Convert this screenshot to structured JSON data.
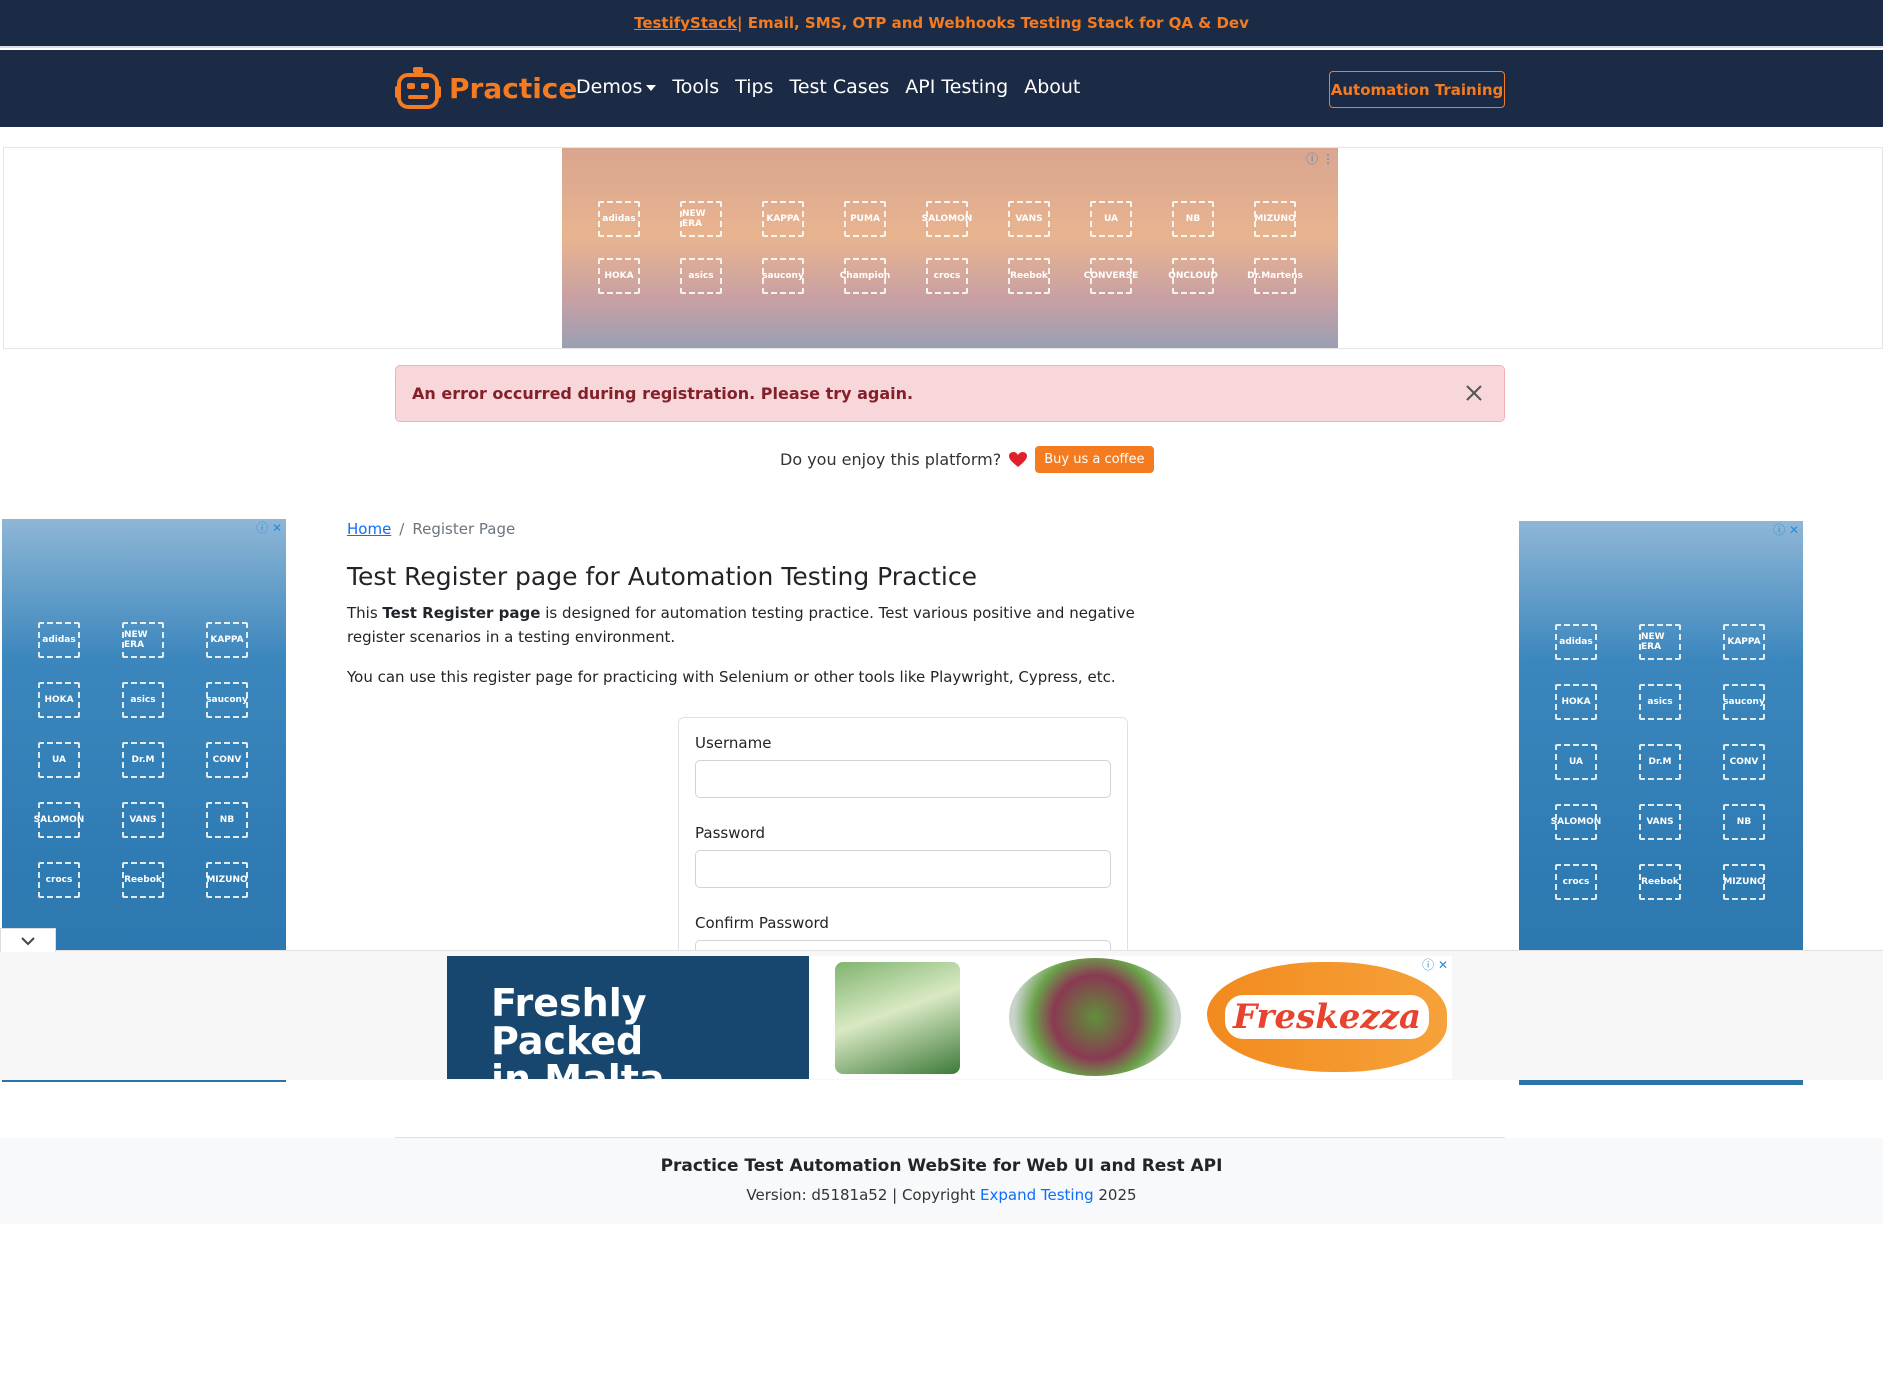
{
  "banner": {
    "link_text": "TestifyStack",
    "text": " | Email, SMS, OTP and Webhooks Testing Stack for QA & Dev"
  },
  "nav": {
    "brand": "Practice",
    "links": [
      "Demos",
      "Tools",
      "Tips",
      "Test Cases",
      "API Testing",
      "About"
    ],
    "cta": "Automation Training"
  },
  "ad_top": {
    "row1": [
      "adidas",
      "NEW ERA",
      "KAPPA",
      "PUMA",
      "SALOMON",
      "VANS",
      "UA",
      "NB",
      "MIZUNO"
    ],
    "row2": [
      "HOKA",
      "asics",
      "saucony",
      "Champion",
      "crocs",
      "Reebok",
      "CONVERSE",
      "ONCLOUD",
      "Dr.Martens"
    ]
  },
  "alert": {
    "message": "An error occurred during registration. Please try again."
  },
  "coffee": {
    "text": "Do you enjoy this platform?",
    "button": "Buy us a coffee"
  },
  "side_ad": {
    "cells": [
      "adidas",
      "NEW ERA",
      "KAPPA",
      "HOKA",
      "asics",
      "saucony",
      "UA",
      "Dr.M",
      "CONV",
      "SALOMON",
      "VANS",
      "NB",
      "crocs",
      "Reebok",
      "MIZUNO"
    ]
  },
  "breadcrumb": {
    "home": "Home",
    "separator": "/",
    "current": "Register Page"
  },
  "page": {
    "title": "Test Register page for Automation Testing Practice",
    "intro_prefix": "This ",
    "intro_bold": "Test Register page",
    "intro_suffix": " is designed for automation testing practice. Test various positive and negative register scenarios in a testing environment.",
    "note": "You can use this register page for practicing with Selenium or other tools like Playwright, Cypress, etc."
  },
  "form": {
    "username_label": "Username",
    "password_label": "Password",
    "confirm_label": "Confirm Password"
  },
  "bottom_ad": {
    "headline_line1": "Freshly Packed",
    "headline_line2": "in Malta",
    "brand": "Freskezza"
  },
  "footer": {
    "title": "Practice Test Automation WebSite for Web UI and Rest API",
    "version_prefix": "Version: d5181a52 | Copyright ",
    "link": "Expand Testing",
    "year": " 2025"
  },
  "colors": {
    "navy": "#1b2a45",
    "accent": "#f47b20",
    "alert_bg": "#f8d7da",
    "alert_text": "#842029",
    "link": "#0d6efd"
  }
}
